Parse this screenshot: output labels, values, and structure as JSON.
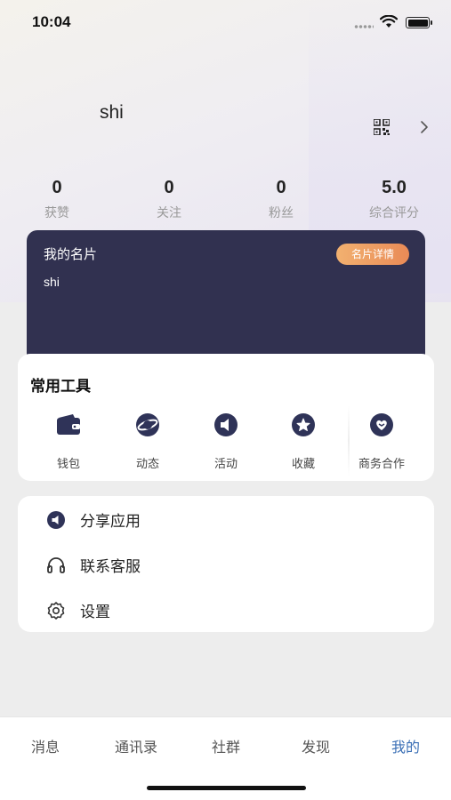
{
  "status": {
    "time": "10:04"
  },
  "profile": {
    "username": "shi"
  },
  "stats": [
    {
      "value": "0",
      "label": "获赞"
    },
    {
      "value": "0",
      "label": "关注"
    },
    {
      "value": "0",
      "label": "粉丝"
    },
    {
      "value": "5.0",
      "label": "综合评分"
    }
  ],
  "card": {
    "title": "我的名片",
    "name": "shi",
    "detail_button": "名片详情"
  },
  "tools": {
    "title": "常用工具",
    "items": [
      {
        "label": "钱包",
        "icon": "wallet-icon"
      },
      {
        "label": "动态",
        "icon": "planet-icon"
      },
      {
        "label": "活动",
        "icon": "megaphone-icon"
      },
      {
        "label": "收藏",
        "icon": "star-icon"
      },
      {
        "label": "商务合作",
        "icon": "handshake-heart-icon"
      }
    ]
  },
  "menu": [
    {
      "label": "分享应用",
      "icon": "share-speaker-icon"
    },
    {
      "label": "联系客服",
      "icon": "headset-icon"
    },
    {
      "label": "设置",
      "icon": "gear-icon"
    }
  ],
  "tabs": [
    {
      "label": "消息",
      "active": false
    },
    {
      "label": "通讯录",
      "active": false
    },
    {
      "label": "社群",
      "active": false
    },
    {
      "label": "发现",
      "active": false
    },
    {
      "label": "我的",
      "active": true
    }
  ],
  "colors": {
    "card_bg": "#313150",
    "accent_tab": "#3a6fb5",
    "badge_gradient_start": "#f2b170",
    "badge_gradient_end": "#e98a56",
    "icon_dark": "#2f3358"
  }
}
